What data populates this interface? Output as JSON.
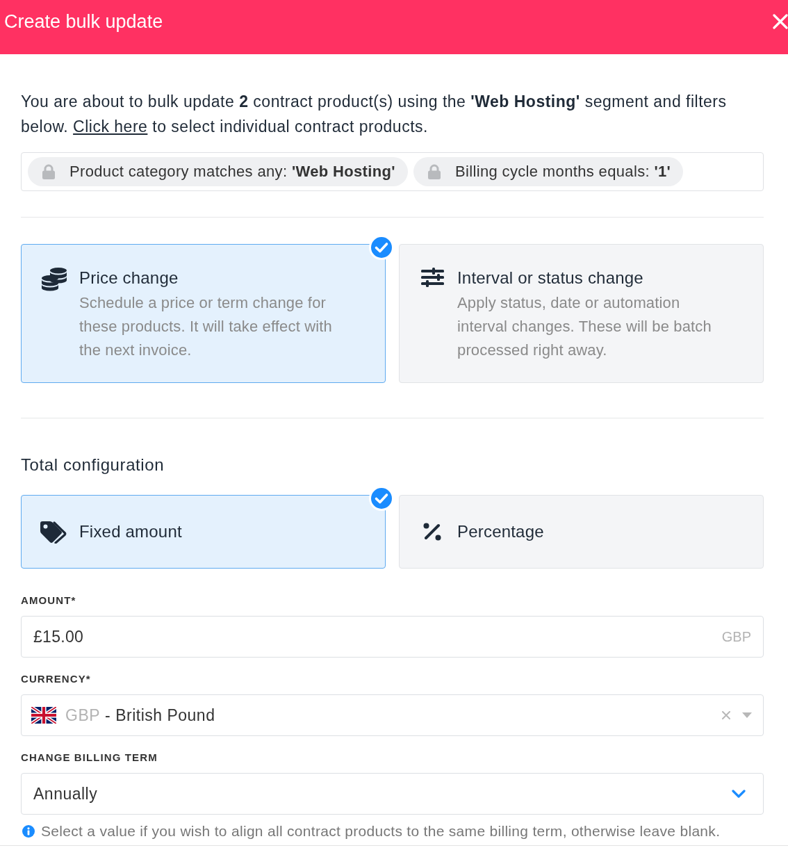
{
  "window": {
    "title": "Create bulk update"
  },
  "intro": {
    "text": "You are about to bulk update **2** contract product(s) using the **'Web Hosting'** segment and filters below.",
    "link": "Click here",
    "after": "to select individual contract products."
  },
  "filters": [
    {
      "text": "Product category matches any: **'Web Hosting'**"
    },
    {
      "text": "Billing cycle months equals: **'1'**"
    }
  ],
  "update_types": [
    {
      "title": "Price change",
      "description": "Schedule a price or term change for these products. It will take effect with the next invoice.",
      "selected": true
    },
    {
      "title": "Interval or status change",
      "description": "Apply status, date or automation interval changes. These will be batch processed right away.",
      "selected": false
    }
  ],
  "total_configuration": {
    "heading": "Total configuration",
    "options": [
      {
        "label": "Fixed amount",
        "selected": true
      },
      {
        "label": "Percentage",
        "selected": false
      }
    ]
  },
  "amount": {
    "label": "AMOUNT*",
    "value": "£15.00",
    "suffix": "GBP"
  },
  "currency": {
    "label": "CURRENCY*",
    "code": "GBP",
    "name": "- British Pound"
  },
  "billing_term": {
    "label": "CHANGE BILLING TERM",
    "value": "Annually",
    "help": "Select a value if you wish to align all contract products to the same billing term, otherwise leave blank."
  }
}
